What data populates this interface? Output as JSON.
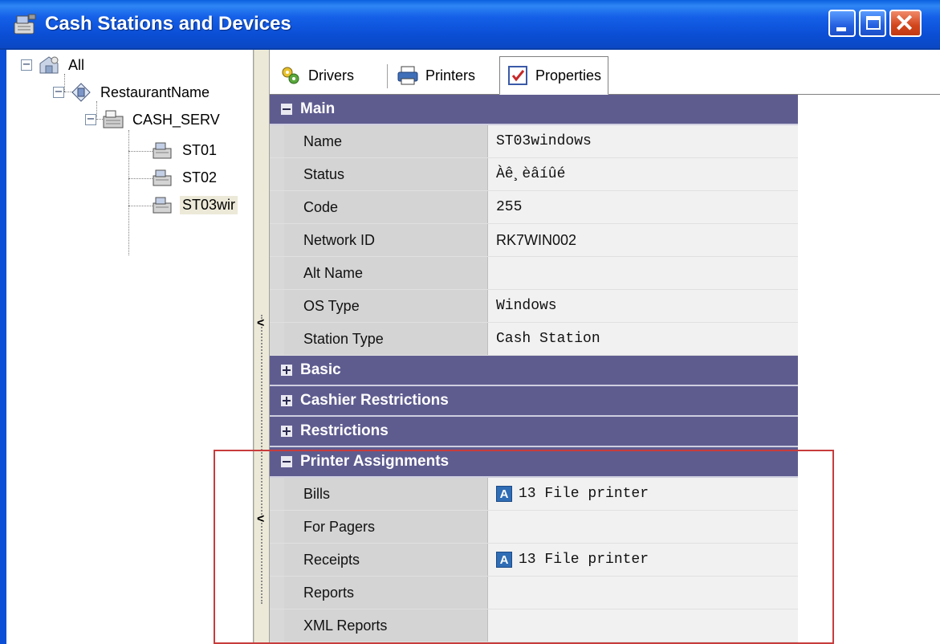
{
  "window": {
    "title": "Cash Stations and Devices",
    "icon": "cash-register-icon",
    "controls": [
      "minimize",
      "maximize",
      "close"
    ]
  },
  "tree": {
    "root": {
      "label": "All",
      "toggle": "−",
      "icon": "network-icon"
    },
    "restaurant": {
      "label": "RestaurantName",
      "toggle": "−",
      "icon": "restaurant-icon"
    },
    "server": {
      "label": "CASH_SERV",
      "toggle": "−",
      "icon": "server-icon"
    },
    "stations": [
      {
        "label": "ST01",
        "icon": "cash-register-icon"
      },
      {
        "label": "ST02",
        "icon": "cash-register-icon"
      },
      {
        "label": "ST03wir",
        "icon": "cash-register-icon",
        "selected": true
      }
    ]
  },
  "tabs": [
    {
      "label": "Drivers",
      "icon": "drivers-icon"
    },
    {
      "label": "Printers",
      "icon": "printer-icon"
    },
    {
      "label": "Properties",
      "icon": "properties-icon",
      "active": true
    }
  ],
  "sections": {
    "main": {
      "title": "Main",
      "expanded": true,
      "rows": [
        {
          "name": "Name",
          "value": "ST03windows"
        },
        {
          "name": "Status",
          "value": "Àê¸èâíûé"
        },
        {
          "name": "Code",
          "value": "255"
        },
        {
          "name": "Network ID",
          "value": "RK7WIN002"
        },
        {
          "name": "Alt Name",
          "value": ""
        },
        {
          "name": "OS Type",
          "value": "Windows"
        },
        {
          "name": "Station Type",
          "value": "Cash Station"
        }
      ]
    },
    "basic": {
      "title": "Basic",
      "expanded": false
    },
    "cashier": {
      "title": "Cashier Restrictions",
      "expanded": false
    },
    "restrictions": {
      "title": "Restrictions",
      "expanded": false
    },
    "printers": {
      "title": "Printer Assignments",
      "expanded": true,
      "rows": [
        {
          "name": "Bills",
          "value": "13 File printer",
          "icon_label": "A"
        },
        {
          "name": "For Pagers",
          "value": ""
        },
        {
          "name": "Receipts",
          "value": "13 File printer",
          "icon_label": "A"
        },
        {
          "name": "Reports",
          "value": ""
        },
        {
          "name": "XML Reports",
          "value": ""
        }
      ]
    }
  },
  "splitter": {
    "arrow": "<"
  },
  "colors": {
    "titlebar": "#0b4fd6",
    "section_header": "#5e5c8f",
    "highlight": "#c83c3c"
  }
}
